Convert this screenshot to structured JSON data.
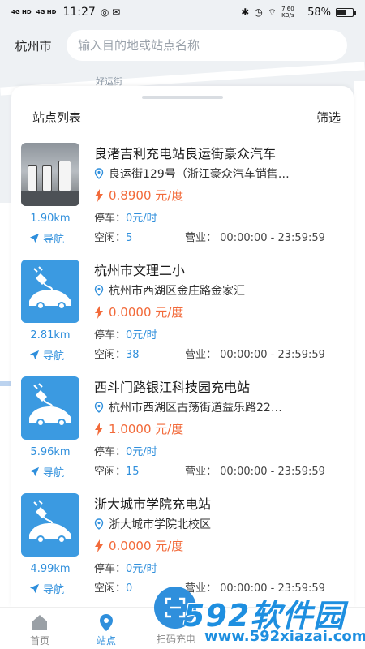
{
  "status": {
    "net1": "4G HD",
    "net2": "4G HD",
    "time": "11:27",
    "speed": "7.60 KB/s",
    "battery": "58%"
  },
  "header": {
    "city": "杭州市",
    "search_placeholder": "输入目的地或站点名称"
  },
  "map_labels": [
    "好运街"
  ],
  "panel": {
    "title": "站点列表",
    "filter_label": "筛选"
  },
  "labels": {
    "navigate": "导航",
    "parking_prefix": "停车：",
    "free_prefix": "空闲：",
    "hours_prefix": "营业："
  },
  "stations": [
    {
      "name": "良渚吉利充电站良运街豪众汽车",
      "address": "良运街129号（浙江豪众汽车销售…",
      "price": "0.8900 元/度",
      "distance": "1.90km",
      "parking": "0元/时",
      "free": "5",
      "hours": "00:00:00 - 23:59:59",
      "thumb": "photo"
    },
    {
      "name": "杭州市文理二小",
      "address": "杭州市西湖区金庄路金家汇",
      "price": "0.0000 元/度",
      "distance": "2.81km",
      "parking": "0元/时",
      "free": "38",
      "hours": "00:00:00 - 23:59:59",
      "thumb": "icon"
    },
    {
      "name": "西斗门路银江科技园充电站",
      "address": "杭州市西湖区古荡街道益乐路22…",
      "price": "1.0000 元/度",
      "distance": "5.96km",
      "parking": "0元/时",
      "free": "15",
      "hours": "00:00:00 - 23:59:59",
      "thumb": "icon"
    },
    {
      "name": "浙大城市学院充电站",
      "address": "浙大城市学院北校区",
      "price": "0.0000 元/度",
      "distance": "4.99km",
      "parking": "0元/时",
      "free": "0",
      "hours": "00:00:00 - 23:59:59",
      "thumb": "icon"
    }
  ],
  "tabs": [
    {
      "label": "首页",
      "icon": "home-icon"
    },
    {
      "label": "站点",
      "icon": "location-pin-icon"
    },
    {
      "label": "扫码充电",
      "icon": "scan-icon"
    }
  ],
  "watermark": {
    "brand": "592软件园",
    "url": "www.592xiazai.com"
  },
  "colors": {
    "accent": "#2f8fdc",
    "price": "#f26a3a"
  }
}
